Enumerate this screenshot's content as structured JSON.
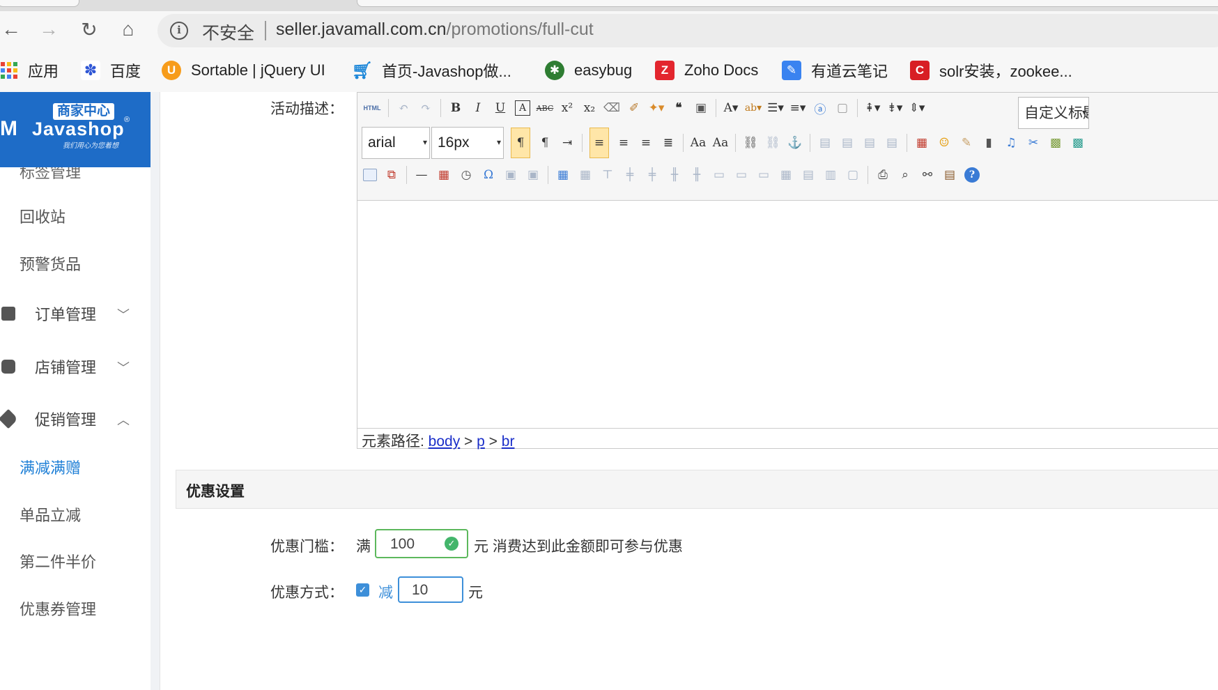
{
  "browser": {
    "security_label": "不安全",
    "url_host": "seller.javamall.com.cn",
    "url_path": "/promotions/full-cut",
    "bookmarks": [
      {
        "label": "应用",
        "icon": "apps-grid-icon"
      },
      {
        "label": "百度",
        "icon": "baidu-paw-icon"
      },
      {
        "label": "Sortable | jQuery UI",
        "icon": "jquery-ui-icon"
      },
      {
        "label": "首页-Javashop做...",
        "icon": "cart-icon"
      },
      {
        "label": "easybug",
        "icon": "bug-icon"
      },
      {
        "label": "Zoho Docs",
        "icon": "zoho-icon"
      },
      {
        "label": "有道云笔记",
        "icon": "youdao-note-icon"
      },
      {
        "label": "solr安装，zookee...",
        "icon": "csdn-icon"
      }
    ]
  },
  "logo": {
    "badge": "商家中心",
    "mark": "M",
    "name": "Javashop",
    "reg": "®",
    "slogan": "我们用心为您着想"
  },
  "sidebar": {
    "partial_item": "标签管理",
    "items": [
      {
        "label": "回收站"
      },
      {
        "label": "预警货品"
      }
    ],
    "groups": [
      {
        "label": "订单管理",
        "chevron": "﹀"
      },
      {
        "label": "店铺管理",
        "chevron": "﹀"
      },
      {
        "label": "促销管理",
        "chevron": "︿"
      }
    ],
    "promo_items": [
      {
        "label": "满减满赠",
        "active": true
      },
      {
        "label": "单品立减"
      },
      {
        "label": "第二件半价"
      },
      {
        "label": "优惠券管理"
      }
    ]
  },
  "form": {
    "description_label": "活动描述：",
    "editor": {
      "html_button": "HTML",
      "font_family": "arial",
      "font_size": "16px",
      "custom_title": "自定义标题",
      "element_path_label": "元素路径: ",
      "element_path": [
        "body",
        "p",
        "br"
      ]
    },
    "discount_section_title": "优惠设置",
    "threshold_label": "优惠门槛：",
    "threshold_prefix": "满",
    "threshold_value": "100",
    "threshold_suffix": "元 消费达到此金额即可参与优惠",
    "method_label": "优惠方式：",
    "reduce_label": "减",
    "reduce_value": "10",
    "reduce_unit": "元"
  },
  "colors": {
    "logo_bg": "#1e6cc7",
    "active_link": "#1e7fd6",
    "valid_green": "#5cb85c"
  }
}
